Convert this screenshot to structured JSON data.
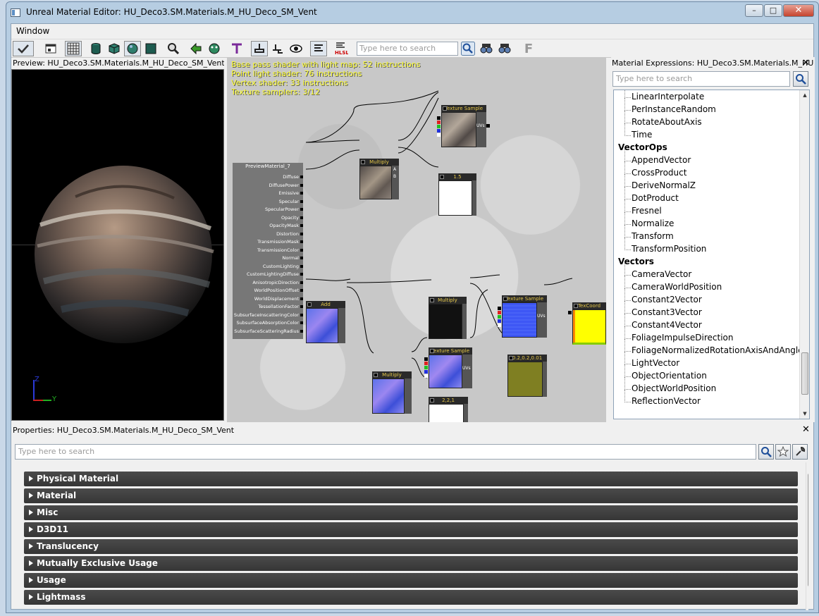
{
  "window": {
    "title": "Unreal Material Editor: HU_Deco3.SM.Materials.M_HU_Deco_SM_Vent",
    "minimize_glyph": "–",
    "maximize_glyph": "□",
    "close_glyph": "✕"
  },
  "menu": {
    "items": [
      "Window"
    ]
  },
  "toolbar": {
    "search_placeholder": "Type here to search",
    "hlsl_label": "HLSL",
    "f_label": "F",
    "icons": [
      "apply-checkmark-icon",
      "fit-to-window-icon",
      "grid-icon",
      "cylinder-preview-icon",
      "cube-preview-icon",
      "sphere-preview-icon",
      "plane-preview-icon",
      "find-icon",
      "go-back-icon",
      "world-icon",
      "toggle-realtime-icon",
      "toggle-lighting-icon",
      "toggle-stats-icon",
      "view-eye-icon",
      "show-stats-icon",
      "hlsl-code-icon",
      "search-go-icon",
      "find-prev-icon",
      "find-next-icon",
      "font-icon"
    ]
  },
  "preview": {
    "title": "Preview: HU_Deco3.SM.Materials.M_HU_Deco_SM_Vent",
    "axis_z": "Z",
    "axis_y": "Y"
  },
  "graph": {
    "stats": [
      "Base pass shader with light map: 52 instructions",
      "Point light shader: 76 instructions",
      "Vertex shader: 33 instructions",
      "Texture samplers: 3/12"
    ],
    "material_node": {
      "title": "PreviewMaterial_7",
      "inputs": [
        "Diffuse",
        "DiffusePower",
        "Emissive",
        "Specular",
        "SpecularPower",
        "Opacity",
        "OpacityMask",
        "Distortion",
        "TransmissionMask",
        "TransmissionColor",
        "Normal",
        "CustomLighting",
        "CustomLightingDiffuse",
        "AnisotropicDirection",
        "WorldPositionOffset",
        "WorldDisplacement",
        "TessellationFactor",
        "SubsurfaceInscatteringColor",
        "SubsurfaceAbsorptionColor",
        "SubsurfaceScatteringRadius"
      ]
    },
    "nodes": {
      "texture_sample_1": "Texture Sample",
      "multiply_1": "Multiply",
      "constant_1": "1.5",
      "add": "Add",
      "multiply_2": "Multiply",
      "texture_sample_2": "Texture Sample",
      "texcoord": "TexCoord",
      "vector_1": "0.2,0.2,0.01",
      "texture_sample_3": "Texture Sample",
      "multiply_3": "Multiply",
      "vector_2": "2,2,1",
      "uvs_label": "UVs",
      "a_label": "A",
      "b_label": "B"
    }
  },
  "expressions": {
    "title": "Material Expressions: HU_Deco3.SM.Materials.M_HU...",
    "search_placeholder": "Type here to search",
    "rows": [
      {
        "type": "item",
        "label": "LinearInterpolate"
      },
      {
        "type": "item",
        "label": "PerInstanceRandom"
      },
      {
        "type": "item",
        "label": "RotateAboutAxis"
      },
      {
        "type": "item",
        "label": "Time"
      },
      {
        "type": "category",
        "label": "VectorOps"
      },
      {
        "type": "item",
        "label": "AppendVector"
      },
      {
        "type": "item",
        "label": "CrossProduct"
      },
      {
        "type": "item",
        "label": "DeriveNormalZ"
      },
      {
        "type": "item",
        "label": "DotProduct"
      },
      {
        "type": "item",
        "label": "Fresnel"
      },
      {
        "type": "item",
        "label": "Normalize"
      },
      {
        "type": "item",
        "label": "Transform"
      },
      {
        "type": "item",
        "label": "TransformPosition"
      },
      {
        "type": "category",
        "label": "Vectors"
      },
      {
        "type": "item",
        "label": "CameraVector"
      },
      {
        "type": "item",
        "label": "CameraWorldPosition"
      },
      {
        "type": "item",
        "label": "Constant2Vector"
      },
      {
        "type": "item",
        "label": "Constant3Vector"
      },
      {
        "type": "item",
        "label": "Constant4Vector"
      },
      {
        "type": "item",
        "label": "FoliageImpulseDirection"
      },
      {
        "type": "item",
        "label": "FoliageNormalizedRotationAxisAndAngle"
      },
      {
        "type": "item",
        "label": "LightVector"
      },
      {
        "type": "item",
        "label": "ObjectOrientation"
      },
      {
        "type": "item",
        "label": "ObjectWorldPosition"
      },
      {
        "type": "item",
        "label": "ReflectionVector"
      }
    ]
  },
  "properties": {
    "title": "Properties: HU_Deco3.SM.Materials.M_HU_Deco_SM_Vent",
    "search_placeholder": "Type here to search",
    "categories": [
      "Physical Material",
      "Material",
      "Misc",
      "D3D11",
      "Translucency",
      "Mutually Exclusive Usage",
      "Usage",
      "Lightmass"
    ]
  },
  "colors": {
    "stats_text": "#ffff33",
    "node_title": "#e6c84a",
    "category_bg": "#3f3f3f",
    "texture_blue": "#3e57f5",
    "texcoord_yellow": "#ffff00",
    "olive": "#7f7f22"
  }
}
